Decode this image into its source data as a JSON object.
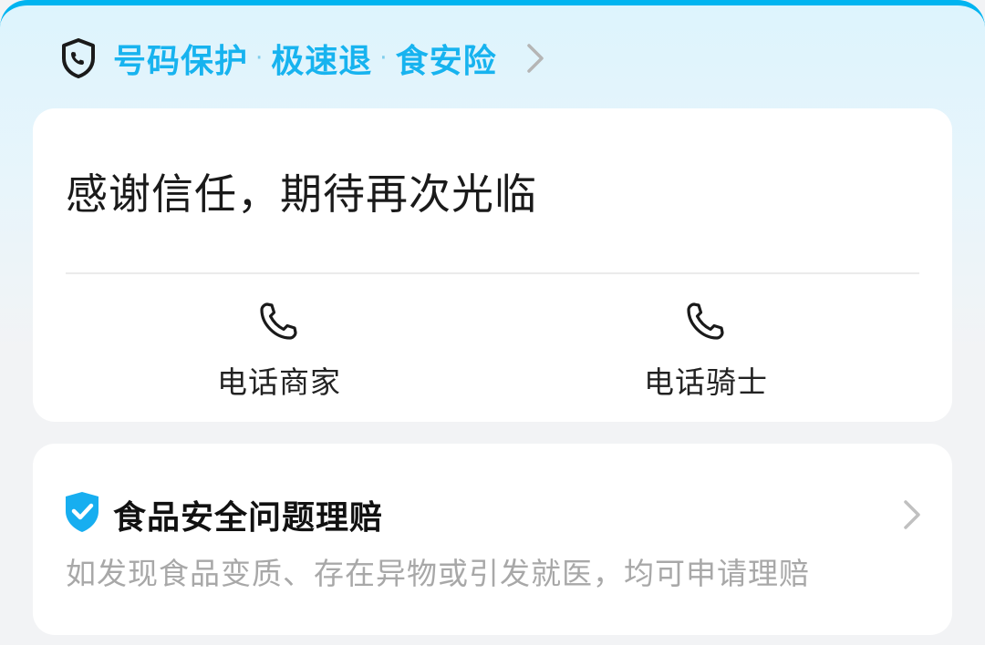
{
  "protection": {
    "items": [
      "号码保护",
      "极速退",
      "食安险"
    ],
    "icons": {
      "shield": "shield-phone-icon",
      "chevron": "chevron-right-icon"
    },
    "accent_color": "#17b3ef"
  },
  "contact_card": {
    "message": "感谢信任，期待再次光临",
    "call_merchant_label": "电话商家",
    "call_rider_label": "电话骑士",
    "icon": "phone-icon"
  },
  "food_safety": {
    "title": "食品安全问题理赔",
    "description": "如发现食品变质、存在异物或引发就医，均可申请理赔",
    "icon": "check-shield-icon",
    "badge_color": "#17aef0"
  }
}
